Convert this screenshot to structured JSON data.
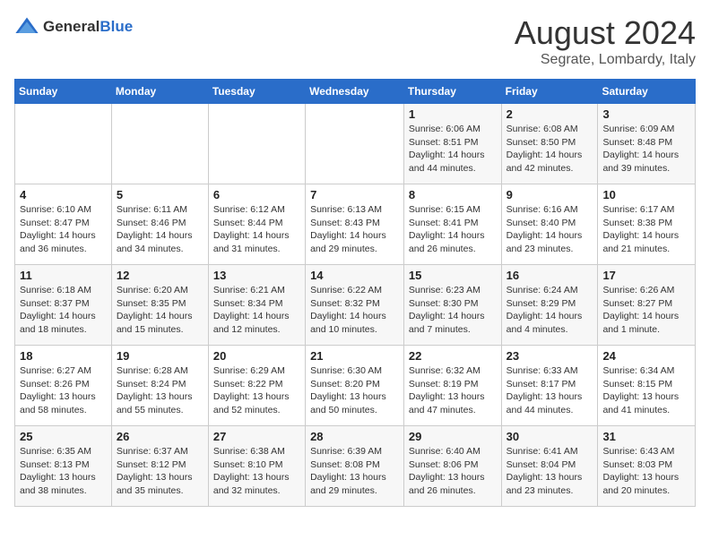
{
  "header": {
    "logo": {
      "general": "General",
      "blue": "Blue"
    },
    "title": "August 2024",
    "subtitle": "Segrate, Lombardy, Italy"
  },
  "weekdays": [
    "Sunday",
    "Monday",
    "Tuesday",
    "Wednesday",
    "Thursday",
    "Friday",
    "Saturday"
  ],
  "weeks": [
    [
      {
        "day": "",
        "info": ""
      },
      {
        "day": "",
        "info": ""
      },
      {
        "day": "",
        "info": ""
      },
      {
        "day": "",
        "info": ""
      },
      {
        "day": "1",
        "info": "Sunrise: 6:06 AM\nSunset: 8:51 PM\nDaylight: 14 hours and 44 minutes."
      },
      {
        "day": "2",
        "info": "Sunrise: 6:08 AM\nSunset: 8:50 PM\nDaylight: 14 hours and 42 minutes."
      },
      {
        "day": "3",
        "info": "Sunrise: 6:09 AM\nSunset: 8:48 PM\nDaylight: 14 hours and 39 minutes."
      }
    ],
    [
      {
        "day": "4",
        "info": "Sunrise: 6:10 AM\nSunset: 8:47 PM\nDaylight: 14 hours and 36 minutes."
      },
      {
        "day": "5",
        "info": "Sunrise: 6:11 AM\nSunset: 8:46 PM\nDaylight: 14 hours and 34 minutes."
      },
      {
        "day": "6",
        "info": "Sunrise: 6:12 AM\nSunset: 8:44 PM\nDaylight: 14 hours and 31 minutes."
      },
      {
        "day": "7",
        "info": "Sunrise: 6:13 AM\nSunset: 8:43 PM\nDaylight: 14 hours and 29 minutes."
      },
      {
        "day": "8",
        "info": "Sunrise: 6:15 AM\nSunset: 8:41 PM\nDaylight: 14 hours and 26 minutes."
      },
      {
        "day": "9",
        "info": "Sunrise: 6:16 AM\nSunset: 8:40 PM\nDaylight: 14 hours and 23 minutes."
      },
      {
        "day": "10",
        "info": "Sunrise: 6:17 AM\nSunset: 8:38 PM\nDaylight: 14 hours and 21 minutes."
      }
    ],
    [
      {
        "day": "11",
        "info": "Sunrise: 6:18 AM\nSunset: 8:37 PM\nDaylight: 14 hours and 18 minutes."
      },
      {
        "day": "12",
        "info": "Sunrise: 6:20 AM\nSunset: 8:35 PM\nDaylight: 14 hours and 15 minutes."
      },
      {
        "day": "13",
        "info": "Sunrise: 6:21 AM\nSunset: 8:34 PM\nDaylight: 14 hours and 12 minutes."
      },
      {
        "day": "14",
        "info": "Sunrise: 6:22 AM\nSunset: 8:32 PM\nDaylight: 14 hours and 10 minutes."
      },
      {
        "day": "15",
        "info": "Sunrise: 6:23 AM\nSunset: 8:30 PM\nDaylight: 14 hours and 7 minutes."
      },
      {
        "day": "16",
        "info": "Sunrise: 6:24 AM\nSunset: 8:29 PM\nDaylight: 14 hours and 4 minutes."
      },
      {
        "day": "17",
        "info": "Sunrise: 6:26 AM\nSunset: 8:27 PM\nDaylight: 14 hours and 1 minute."
      }
    ],
    [
      {
        "day": "18",
        "info": "Sunrise: 6:27 AM\nSunset: 8:26 PM\nDaylight: 13 hours and 58 minutes."
      },
      {
        "day": "19",
        "info": "Sunrise: 6:28 AM\nSunset: 8:24 PM\nDaylight: 13 hours and 55 minutes."
      },
      {
        "day": "20",
        "info": "Sunrise: 6:29 AM\nSunset: 8:22 PM\nDaylight: 13 hours and 52 minutes."
      },
      {
        "day": "21",
        "info": "Sunrise: 6:30 AM\nSunset: 8:20 PM\nDaylight: 13 hours and 50 minutes."
      },
      {
        "day": "22",
        "info": "Sunrise: 6:32 AM\nSunset: 8:19 PM\nDaylight: 13 hours and 47 minutes."
      },
      {
        "day": "23",
        "info": "Sunrise: 6:33 AM\nSunset: 8:17 PM\nDaylight: 13 hours and 44 minutes."
      },
      {
        "day": "24",
        "info": "Sunrise: 6:34 AM\nSunset: 8:15 PM\nDaylight: 13 hours and 41 minutes."
      }
    ],
    [
      {
        "day": "25",
        "info": "Sunrise: 6:35 AM\nSunset: 8:13 PM\nDaylight: 13 hours and 38 minutes."
      },
      {
        "day": "26",
        "info": "Sunrise: 6:37 AM\nSunset: 8:12 PM\nDaylight: 13 hours and 35 minutes."
      },
      {
        "day": "27",
        "info": "Sunrise: 6:38 AM\nSunset: 8:10 PM\nDaylight: 13 hours and 32 minutes."
      },
      {
        "day": "28",
        "info": "Sunrise: 6:39 AM\nSunset: 8:08 PM\nDaylight: 13 hours and 29 minutes."
      },
      {
        "day": "29",
        "info": "Sunrise: 6:40 AM\nSunset: 8:06 PM\nDaylight: 13 hours and 26 minutes."
      },
      {
        "day": "30",
        "info": "Sunrise: 6:41 AM\nSunset: 8:04 PM\nDaylight: 13 hours and 23 minutes."
      },
      {
        "day": "31",
        "info": "Sunrise: 6:43 AM\nSunset: 8:03 PM\nDaylight: 13 hours and 20 minutes."
      }
    ]
  ]
}
